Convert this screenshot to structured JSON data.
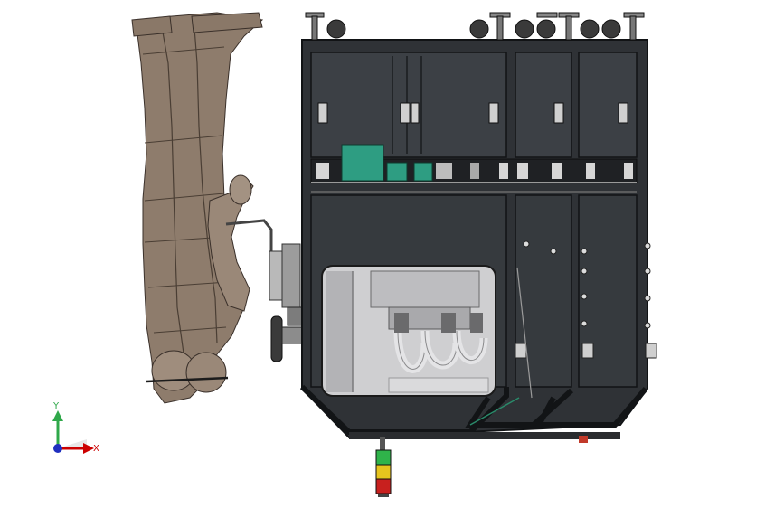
{
  "viewport": {
    "background": "#ffffff",
    "model": {
      "frame_color": "#2f3236",
      "frame_edge_color": "#111315",
      "figure_color": "#8e7c6c",
      "figure_shadow_color": "#5e5044",
      "board_color": "#2e9d82",
      "tube_color": "#d8d8da",
      "beacon_colors": [
        "#2fb34a",
        "#e6c41e",
        "#c8201e"
      ]
    },
    "triad": {
      "x_label": "X",
      "y_label": "Y",
      "x_color": "#cc0000",
      "y_color": "#2fa84a",
      "z_color": "#1f2fbf"
    }
  }
}
